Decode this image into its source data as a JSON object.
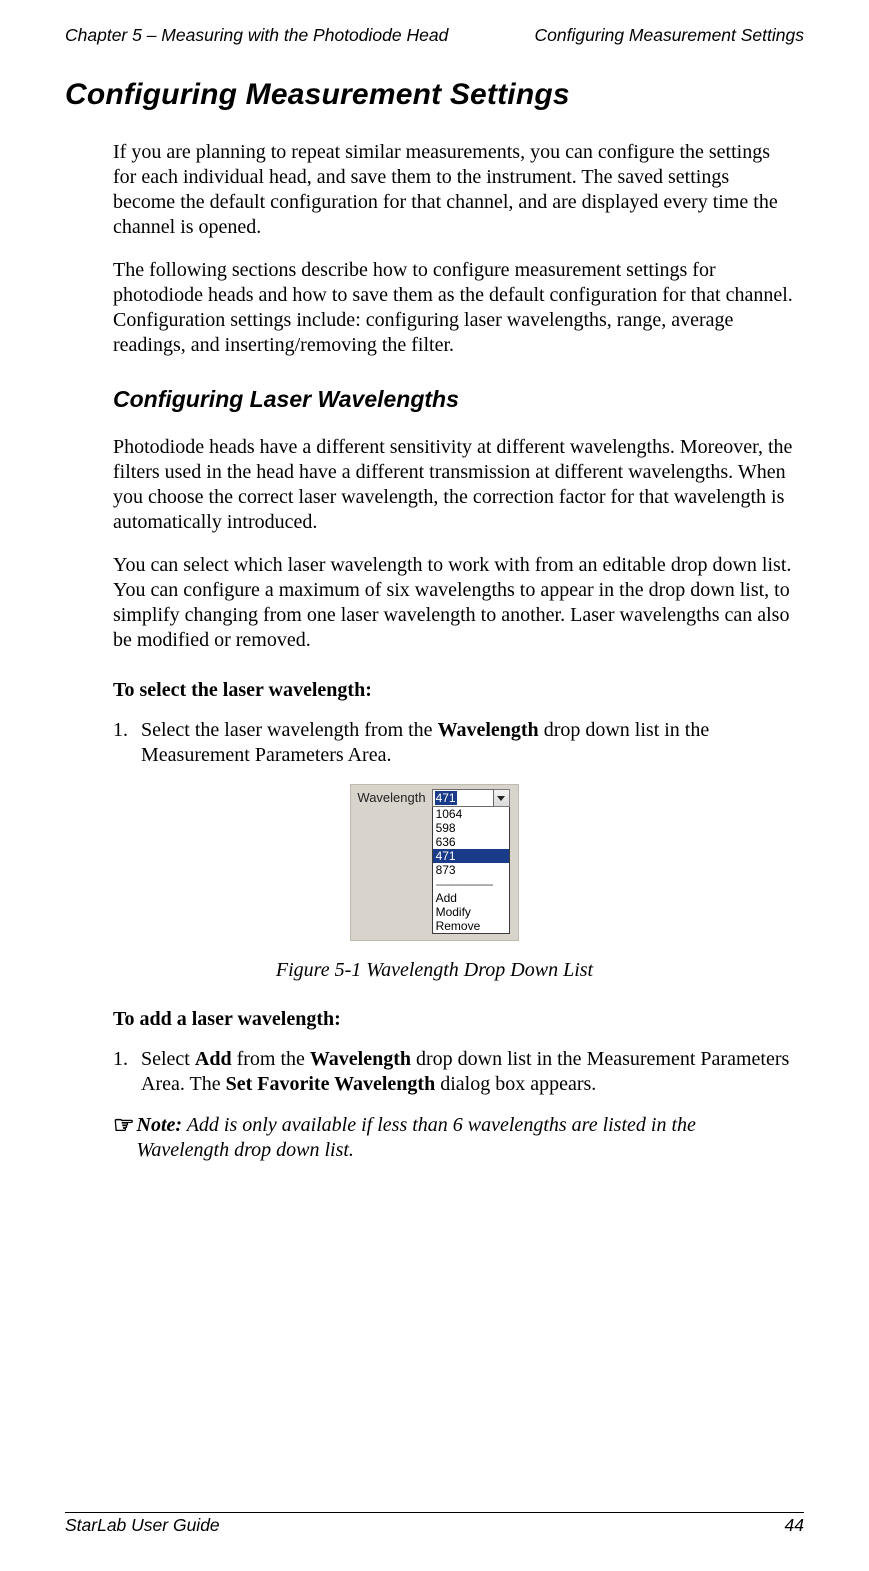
{
  "header": {
    "left": "Chapter 5 – Measuring with the Photodiode Head",
    "right": "Configuring Measurement Settings"
  },
  "h1": "Configuring Measurement Settings",
  "p1": "If you are planning to repeat similar measurements, you can configure the settings for each individual head, and save them to the instrument. The saved settings become the default configuration for that channel, and are displayed every time the channel is opened.",
  "p2": "The following sections describe how to configure measurement settings for photodiode heads and how to save them as the default configuration for that channel. Configuration settings include: configuring laser wavelengths, range, average readings, and inserting/removing the filter.",
  "h2": "Configuring Laser Wavelengths",
  "p3": "Photodiode heads have a different sensitivity at different wavelengths. Moreover, the filters used in the head have a different transmission at different wavelengths. When you choose the correct laser wavelength, the correction factor for that wavelength is automatically introduced.",
  "p4": "You can select which laser wavelength to work with from an editable drop down list. You can configure a maximum of six wavelengths to appear in the drop down list, to simplify changing from one laser wavelength to another. Laser wavelengths can also be modified or removed.",
  "procSelect": "To select the laser wavelength:",
  "step1_pre": "Select the laser wavelength from the ",
  "step1_bold": "Wavelength",
  "step1_post": " drop down list in the Measurement Parameters Area.",
  "dropdown": {
    "label": "Wavelength",
    "selected": "471",
    "options": [
      "1064",
      "598",
      "636",
      "471",
      "873"
    ],
    "actions": [
      "Add",
      "Modify",
      "Remove"
    ]
  },
  "figcap": "Figure 5-1 Wavelength Drop Down List",
  "procAdd": "To add a laser wavelength:",
  "add1_a": "Select ",
  "add1_b": "Add",
  "add1_c": " from the ",
  "add1_d": "Wavelength",
  "add1_e": " drop down list in the Measurement Parameters Area. The ",
  "add1_f": "Set Favorite Wavelength",
  "add1_g": " dialog box appears.",
  "note_label": "Note:",
  "note_body": " Add is only available if less than 6 wavelengths are listed in the Wavelength drop down list.",
  "footer": {
    "left": "StarLab User Guide",
    "right": "44"
  }
}
